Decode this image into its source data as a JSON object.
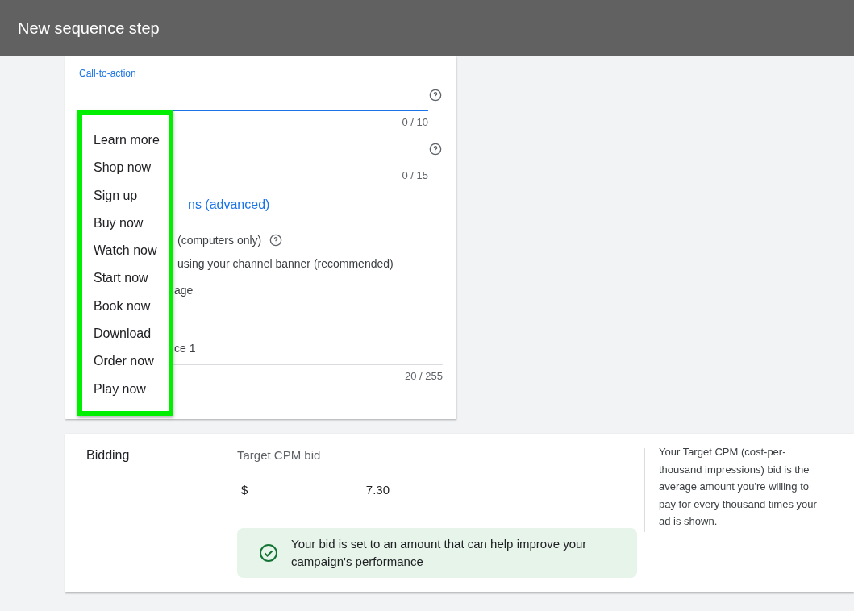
{
  "header": {
    "title": "New sequence step"
  },
  "form": {
    "cta_field": {
      "label": "Call-to-action",
      "focused": true,
      "counter": "0 / 10"
    },
    "headline_field": {
      "counter": "0 / 15"
    },
    "advanced_link": "ns (advanced)",
    "companion_label": "(computers only)",
    "options": [
      "using your channel banner (recommended)",
      "age"
    ],
    "value_fragment": "ce 1",
    "description_counter": "20 / 255"
  },
  "cta_menu": {
    "items": [
      {
        "label": "Learn more"
      },
      {
        "label": "Shop now"
      },
      {
        "label": "Sign up"
      },
      {
        "label": "Buy now"
      },
      {
        "label": "Watch now"
      },
      {
        "label": "Start now"
      },
      {
        "label": "Book now"
      },
      {
        "label": "Download"
      },
      {
        "label": "Order now"
      },
      {
        "label": "Play now"
      }
    ]
  },
  "bidding": {
    "title": "Bidding",
    "bid_label": "Target CPM bid",
    "currency": "$",
    "bid_value": "7.30",
    "notice": "Your bid is set to an amount that can help improve your campaign's performance",
    "help": "Your Target CPM (cost-per-thousand impressions) bid is the average amount you're willing to pay for every thousand times your ad is shown."
  }
}
